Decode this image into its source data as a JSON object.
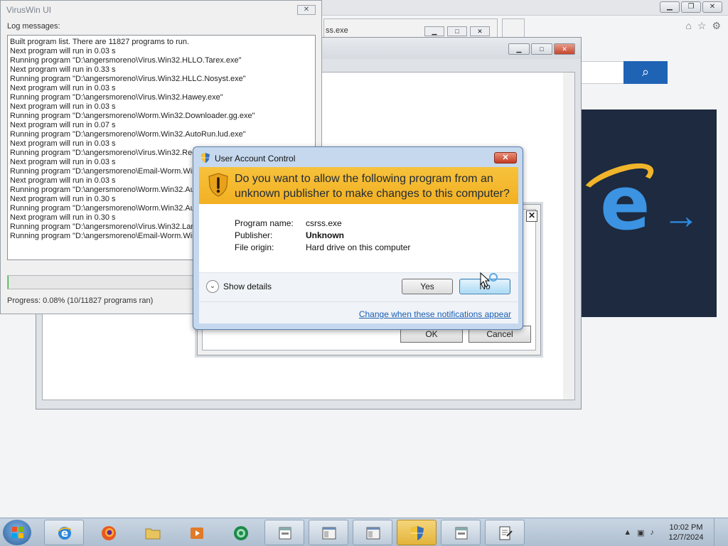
{
  "log_window": {
    "title": "VirusWin UI",
    "close_label": "✕",
    "log_label": "Log messages:",
    "log_lines": [
      "Built program list. There are 11827 programs to run.",
      "Next program will run in 0.03 s",
      "Running program \"D:\\angersmoreno\\Virus.Win32.HLLO.Tarex.exe\"",
      "Next program will run in 0.33 s",
      "Running program \"D:\\angersmoreno\\Virus.Win32.HLLC.Nosyst.exe\"",
      "Next program will run in 0.03 s",
      "Running program \"D:\\angersmoreno\\Virus.Win32.Hawey.exe\"",
      "Next program will run in 0.03 s",
      "Running program \"D:\\angersmoreno\\Worm.Win32.Downloader.gg.exe\"",
      "Next program will run in 0.07 s",
      "Running program \"D:\\angersmoreno\\Worm.Win32.AutoRun.lud.exe\"",
      "Next program will run in 0.03 s",
      "Running program \"D:\\angersmoreno\\Virus.Win32.Red",
      "Next program will run in 0.03 s",
      "Running program \"D:\\angersmoreno\\Email-Worm.Win",
      "Next program will run in 0.03 s",
      "Running program \"D:\\angersmoreno\\Worm.Win32.Aut",
      "Next program will run in 0.30 s",
      "Running program \"D:\\angersmoreno\\Worm.Win32.Aut",
      "Next program will run in 0.30 s",
      "Running program \"D:\\angersmoreno\\Virus.Win32.Lam",
      "Running program \"D:\\angersmoreno\\Email-Worm.Win"
    ],
    "progress_fraction": 0.0008,
    "progress_text": "Progress: 0.08% (10/11827 programs ran)"
  },
  "background_tab": {
    "text": "ss.exe"
  },
  "secondary_dialog": {
    "close_label": "✕",
    "ok_label": "OK",
    "cancel_label": "Cancel"
  },
  "uac": {
    "title": "User Account Control",
    "close_label": "✕",
    "question": "Do you want to allow the following program from an unknown publisher to make changes to this computer?",
    "fields": [
      {
        "key": "Program name:",
        "value": "csrss.exe"
      },
      {
        "key": "Publisher:",
        "value": "Unknown"
      },
      {
        "key": "File origin:",
        "value": "Hard drive on this computer"
      }
    ],
    "show_details_label": "Show details",
    "yes_label": "Yes",
    "no_label": "No",
    "link_label": "Change when these notifications appear"
  },
  "taskbar": {
    "items": [
      {
        "name": "internet-explorer-taskbar-item",
        "icon": "ie-icon",
        "active": false,
        "plain": false
      },
      {
        "name": "firefox-taskbar-item",
        "icon": "firefox-icon",
        "active": false,
        "plain": true
      },
      {
        "name": "file-explorer-taskbar-item",
        "icon": "folder-icon",
        "active": false,
        "plain": true
      },
      {
        "name": "media-player-taskbar-item",
        "icon": "media-icon",
        "active": false,
        "plain": true
      },
      {
        "name": "green-app-taskbar-item",
        "icon": "green-circle-icon",
        "active": false,
        "plain": true
      },
      {
        "name": "exe-window-taskbar-item-1",
        "icon": "exe-icon",
        "active": false,
        "plain": false
      },
      {
        "name": "window-taskbar-item-2",
        "icon": "window-icon",
        "active": false,
        "plain": false
      },
      {
        "name": "window-taskbar-item-3",
        "icon": "window-icon",
        "active": false,
        "plain": false
      },
      {
        "name": "uac-taskbar-item",
        "icon": "shield-icon",
        "active": true,
        "plain": false
      },
      {
        "name": "exe-window-taskbar-item-4",
        "icon": "exe-icon",
        "active": false,
        "plain": false
      },
      {
        "name": "notepad-taskbar-item",
        "icon": "notepad-icon",
        "active": false,
        "plain": false
      }
    ],
    "clock_time": "10:02 PM",
    "clock_date": "12/7/2024"
  },
  "colors": {
    "uac_header": "#f2b022",
    "link": "#1a5fb4",
    "search_button": "#1f63b5"
  }
}
